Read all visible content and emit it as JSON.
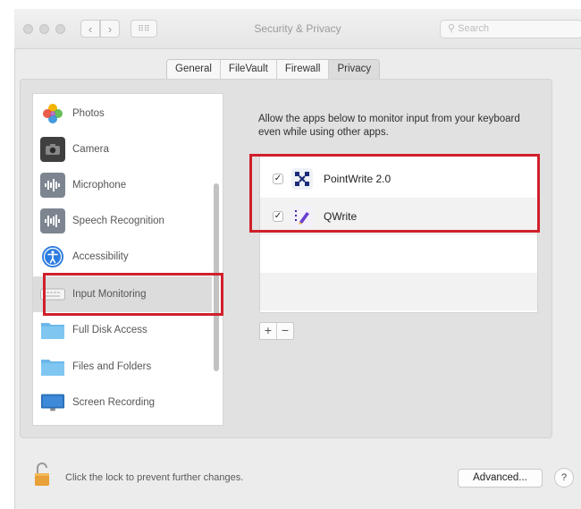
{
  "window": {
    "title": "Security & Privacy",
    "search_placeholder": "Search",
    "grid_icon_label": "⠿⠿"
  },
  "tabs": [
    {
      "label": "General",
      "active": false
    },
    {
      "label": "FileVault",
      "active": false
    },
    {
      "label": "Firewall",
      "active": false
    },
    {
      "label": "Privacy",
      "active": true
    }
  ],
  "sidebar": {
    "items": [
      {
        "label": "Photos",
        "icon": "photos-icon"
      },
      {
        "label": "Camera",
        "icon": "camera-icon"
      },
      {
        "label": "Microphone",
        "icon": "microphone-icon"
      },
      {
        "label": "Speech Recognition",
        "icon": "speech-recognition-icon"
      },
      {
        "label": "Accessibility",
        "icon": "accessibility-icon"
      },
      {
        "label": "Input Monitoring",
        "icon": "keyboard-icon",
        "selected": true
      },
      {
        "label": "Full Disk Access",
        "icon": "folder-icon"
      },
      {
        "label": "Files and Folders",
        "icon": "folder-icon"
      },
      {
        "label": "Screen Recording",
        "icon": "display-icon"
      }
    ]
  },
  "main": {
    "description": "Allow the apps below to monitor input from your keyboard even while using other apps.",
    "apps": [
      {
        "name": "PointWrite 2.0",
        "checked": true,
        "icon": "pointwrite-app-icon"
      },
      {
        "name": "QWrite",
        "checked": true,
        "icon": "qwrite-app-icon"
      }
    ],
    "add_label": "+",
    "remove_label": "−"
  },
  "footer": {
    "lock_text": "Click the lock to prevent further changes.",
    "advanced_label": "Advanced...",
    "help_label": "?"
  },
  "colors": {
    "highlight": "#d0202b",
    "folder_blue": "#6cb8ea"
  }
}
